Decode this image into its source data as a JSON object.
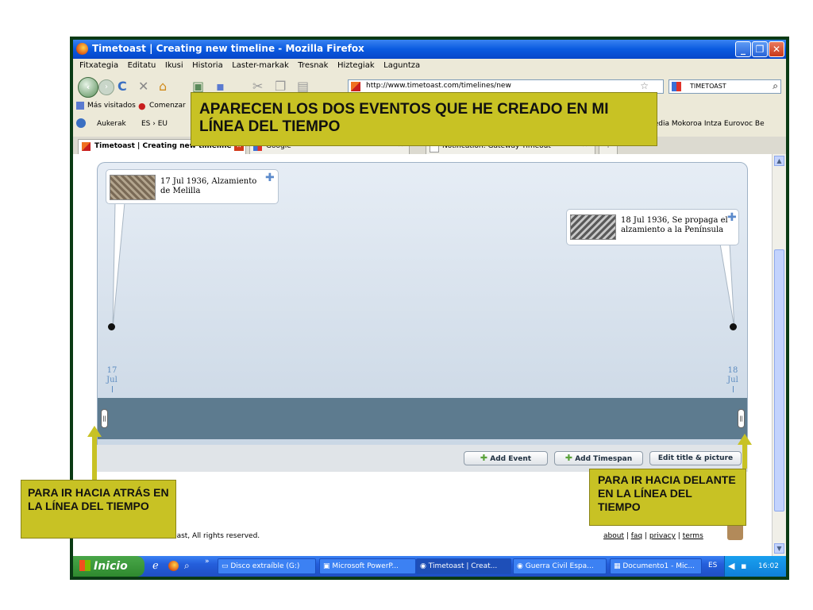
{
  "window": {
    "title": "Timetoast | Creating new timeline - Mozilla Firefox",
    "controls": [
      "_",
      "❐",
      "✕"
    ]
  },
  "menu": [
    "Fitxategia",
    "Editatu",
    "Ikusi",
    "Historia",
    "Laster-markak",
    "Tresnak",
    "Hiztegiak",
    "Laguntza"
  ],
  "nav": {
    "url": "http://www.timetoast.com/timelines/new",
    "search_label": "TIMETOAST"
  },
  "bookmarks": {
    "items": [
      "Más visitados",
      "Comenzar"
    ]
  },
  "toolbar2": {
    "left": [
      "Aukerak",
      "ES › EU"
    ],
    "right": "pedia Mokoroa Intza Eurovoc Be"
  },
  "tabs": [
    {
      "label": "Timetoast | Creating new timeline"
    },
    {
      "label": "Google"
    },
    {
      "label": "Notification: Gateway Timeout"
    }
  ],
  "timeline": {
    "events": [
      {
        "label": "17 Jul 1936, Alzamiento de Melilla"
      },
      {
        "label": "18 Jul 1936, Se propaga el alzamiento a la Península"
      }
    ],
    "ticks": [
      {
        "day": "17",
        "month": "Jul"
      },
      {
        "day": "18",
        "month": "Jul"
      }
    ],
    "buttons": {
      "add_event": "Add Event",
      "add_timespan": "Add Timespan",
      "edit_title": "Edit title & picture"
    }
  },
  "footer": {
    "copyright": "etoast, All rights reserved.",
    "links": [
      "about",
      "faq",
      "privacy",
      "terms"
    ]
  },
  "taskbar": {
    "start": "Inicio",
    "tasks": [
      "Disco extraíble (G:)",
      "Microsoft PowerP...",
      "Timetoast | Creat...",
      "Guerra Civil Espa...",
      "Documento1 - Mic..."
    ],
    "lang": "ES",
    "clock": "16:02"
  },
  "callouts": {
    "top": "APARECEN LOS DOS EVENTOS QUE HE CREADO EN MI LÍNEA DEL TIEMPO",
    "left": "PARA IR HACIA ATRÁS EN LA LÍNEA DEL TIEMPO",
    "right": "PARA IR HACIA DELANTE EN LA LÍNEA DEL TIEMPO"
  },
  "colors": {
    "callout": "#c8c224",
    "band": "#5d7b8f",
    "titlebar": "#0a5ae0"
  }
}
